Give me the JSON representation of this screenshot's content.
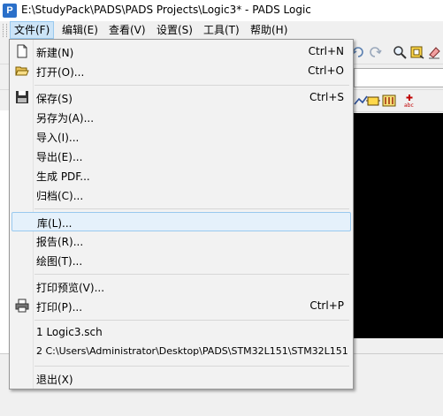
{
  "window": {
    "title": "E:\\StudyPack\\PADS\\PADS Projects\\Logic3* - PADS Logic"
  },
  "menubar": [
    {
      "label": "文件(F)"
    },
    {
      "label": "编辑(E)"
    },
    {
      "label": "查看(V)"
    },
    {
      "label": "设置(S)"
    },
    {
      "label": "工具(T)"
    },
    {
      "label": "帮助(H)"
    }
  ],
  "file_menu": {
    "items": [
      {
        "label": "新建(N)",
        "shortcut": "Ctrl+N",
        "icon": "new-file-icon"
      },
      {
        "label": "打开(O)...",
        "shortcut": "Ctrl+O",
        "icon": "open-folder-icon"
      },
      {
        "label": "保存(S)",
        "shortcut": "Ctrl+S",
        "icon": "save-icon"
      },
      {
        "label": "另存为(A)...",
        "shortcut": ""
      },
      {
        "label": "导入(I)...",
        "shortcut": ""
      },
      {
        "label": "导出(E)...",
        "shortcut": ""
      },
      {
        "label": "生成 PDF...",
        "shortcut": ""
      },
      {
        "label": "归档(C)...",
        "shortcut": ""
      },
      {
        "label": "库(L)...",
        "shortcut": "",
        "highlighted": true
      },
      {
        "label": "报告(R)...",
        "shortcut": ""
      },
      {
        "label": "绘图(T)...",
        "shortcut": ""
      },
      {
        "label": "打印预览(V)...",
        "shortcut": ""
      },
      {
        "label": "打印(P)...",
        "shortcut": "Ctrl+P",
        "icon": "printer-icon"
      },
      {
        "label": "1 Logic3.sch",
        "shortcut": ""
      },
      {
        "label": "2 C:\\Users\\Administrator\\Desktop\\PADS\\STM32L151\\STM32L151",
        "shortcut": ""
      },
      {
        "label": "退出(X)",
        "shortcut": ""
      }
    ]
  },
  "colors": {
    "canvas": "#000000",
    "highlight": "#e5f1fb",
    "highlight_border": "#99c9ef",
    "menu_active": "#cce4f7"
  }
}
